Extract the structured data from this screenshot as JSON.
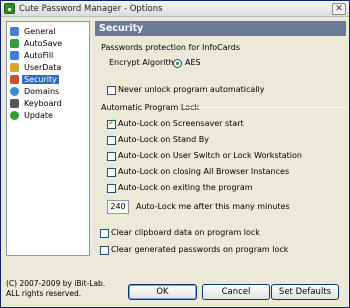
{
  "window": {
    "title": "Cute Password Manager - Options"
  },
  "nav": {
    "items": [
      {
        "label": "General",
        "icon": "general-icon",
        "color": "#4a7bd6"
      },
      {
        "label": "AutoSave",
        "icon": "autosave-icon",
        "color": "#2f9e3a"
      },
      {
        "label": "AutoFill",
        "icon": "autofill-icon",
        "color": "#3f7fd0"
      },
      {
        "label": "UserData",
        "icon": "userdata-icon",
        "color": "#d6a33b"
      },
      {
        "label": "Security",
        "icon": "security-icon",
        "color": "#d04b3b",
        "selected": true
      },
      {
        "label": "Domains",
        "icon": "domains-icon",
        "color": "#3b8bd0"
      },
      {
        "label": "Keyboard",
        "icon": "keyboard-icon",
        "color": "#555555"
      },
      {
        "label": "Update",
        "icon": "update-icon",
        "color": "#2f9e3a"
      }
    ]
  },
  "panel": {
    "header": "Security",
    "passwords_protection_label": "Passwords protection for InfoCards",
    "encrypt_algorithm_label": "Encrypt Algorithm",
    "aes_label": "AES",
    "never_unlock_label": "Never unlock program automatically",
    "auto_lock_section": "Automatic Program Lock",
    "options": [
      {
        "label": "Auto-Lock on Screensaver start",
        "checked": true
      },
      {
        "label": "Auto-Lock on Stand By",
        "checked": false
      },
      {
        "label": "Auto-Lock on User Switch or Lock Workstation",
        "checked": false
      },
      {
        "label": "Auto-Lock on closing All Browser Instances",
        "checked": false
      },
      {
        "label": "Auto-Lock on exiting the program",
        "checked": false
      }
    ],
    "minutes_value": "240",
    "minutes_label": "Auto-Lock me after this many minutes",
    "clear_clipboard_label": "Clear clipboard data on program lock",
    "clear_generated_label": "Clear generated passwords on program lock"
  },
  "footer": {
    "copyright_line1": "(C) 2007-2009 by iBit-Lab.",
    "copyright_line2": "ALL rights reserved.",
    "ok_label": "OK",
    "cancel_label": "Cancel",
    "set_defaults_label": "Set Defaults"
  }
}
